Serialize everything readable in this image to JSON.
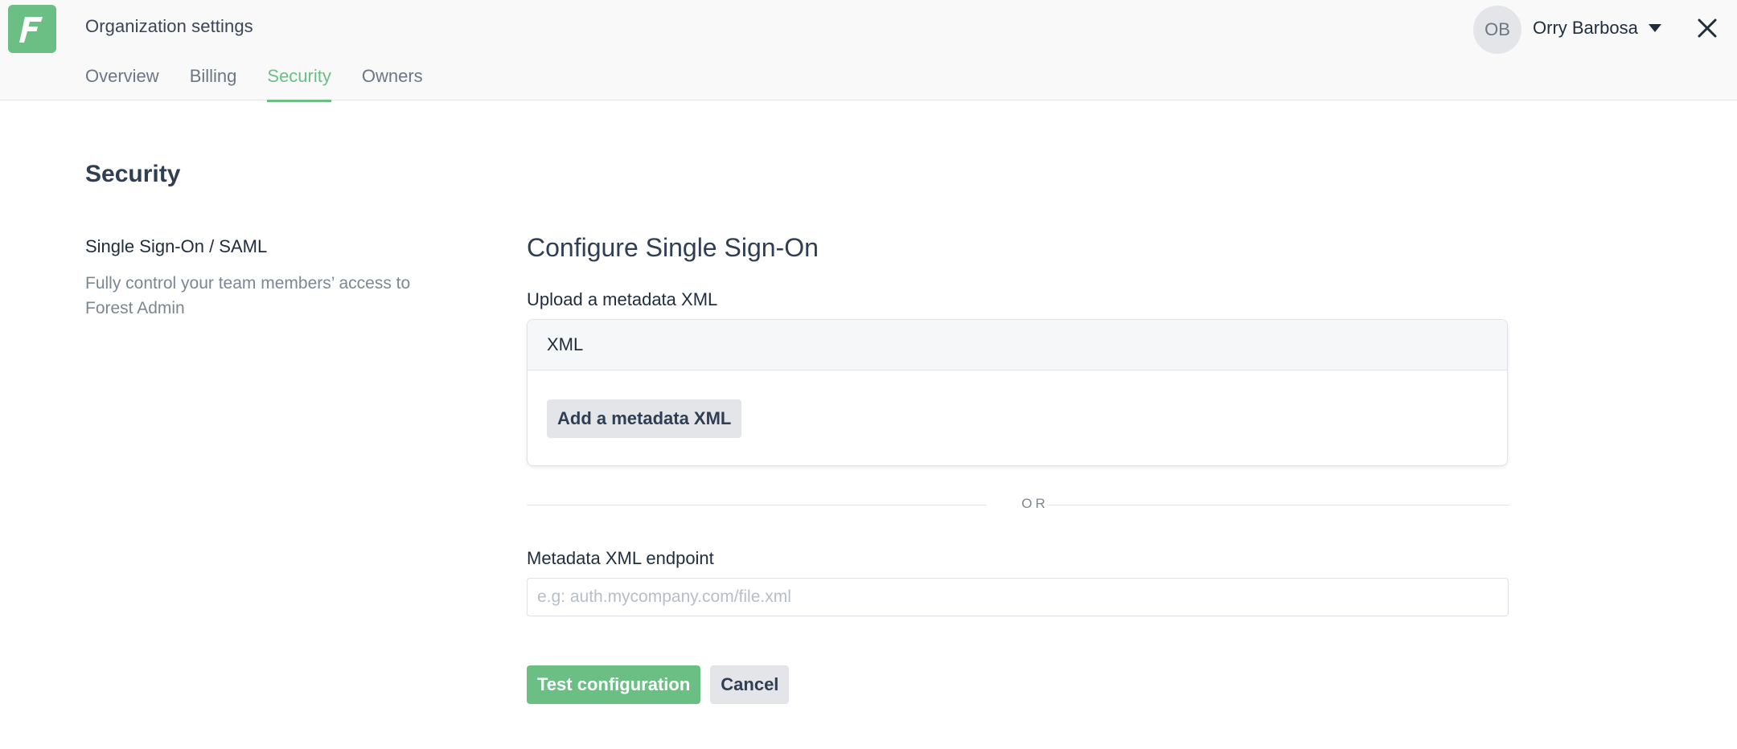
{
  "header": {
    "title": "Organization settings",
    "tabs": [
      {
        "label": "Overview",
        "active": false
      },
      {
        "label": "Billing",
        "active": false
      },
      {
        "label": "Security",
        "active": true
      },
      {
        "label": "Owners",
        "active": false
      }
    ],
    "user": {
      "initials": "OB",
      "name": "Orry Barbosa"
    },
    "icons": {
      "logo": "forest-logo-icon",
      "dropdown": "caret-down-icon",
      "close": "close-icon"
    }
  },
  "page": {
    "title": "Security",
    "section": {
      "title": "Single Sign-On / SAML",
      "description": "Fully control your team members’ access to Forest Admin"
    },
    "config": {
      "title": "Configure Single Sign-On",
      "upload_label": "Upload a metadata XML",
      "card_header": "XML",
      "add_button": "Add a metadata XML",
      "or_text": "OR",
      "endpoint_label": "Metadata XML endpoint",
      "endpoint_placeholder": "e.g: auth.mycompany.com/file.xml",
      "endpoint_value": ""
    },
    "actions": {
      "test": "Test configuration",
      "cancel": "Cancel"
    }
  },
  "colors": {
    "accent": "#6cbf84",
    "text": "#1f2d3d",
    "muted": "#7c8794",
    "border": "#dfe2e6"
  }
}
